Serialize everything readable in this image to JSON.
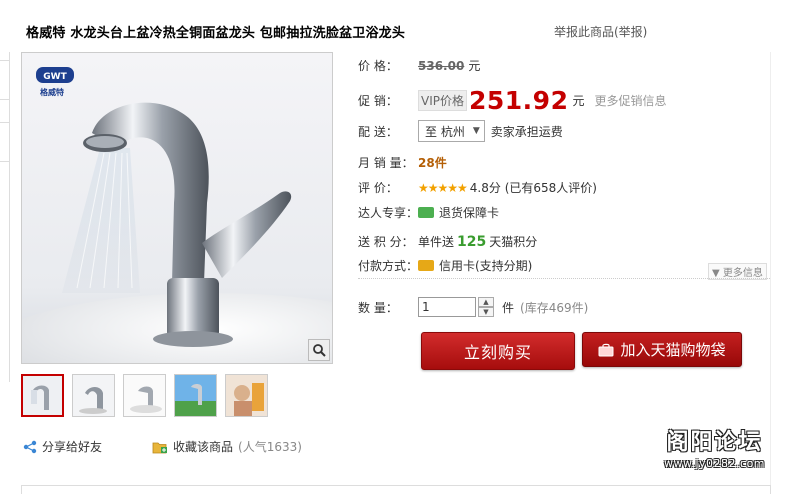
{
  "product": {
    "title": "格威特  水龙头台上盆冷热全铜面盆龙头  包邮抽拉洗脸盆卫浴龙头",
    "report": "举报此商品(举报)"
  },
  "image": {
    "brand_badge": "GWT",
    "brand_name": "格威特"
  },
  "price": {
    "label": "价    格：",
    "original": "536.00",
    "unit": "元",
    "promo_label": "促    销：",
    "vip_tag": "VIP价格",
    "current": "251.92",
    "more_promo": "更多促销信息"
  },
  "delivery": {
    "label": "配    送：",
    "destination": "至 杭州",
    "shipping": "卖家承担运费"
  },
  "sales": {
    "label": "月 销 量：",
    "value": "28件"
  },
  "rating": {
    "label": "评    价：",
    "stars": "★★★★★",
    "score": "4.8分 (已有658人评价)"
  },
  "expert": {
    "label": "达人专享：",
    "value": "退货保障卡"
  },
  "points": {
    "label": "送 积 分：",
    "prefix": "单件送",
    "value": "125",
    "suffix": "天猫积分"
  },
  "payment": {
    "label": "付款方式：",
    "value": "信用卡(支持分期)",
    "more": "更多信息"
  },
  "quantity": {
    "label": "数    量：",
    "value": "1",
    "unit": "件",
    "stock": "(库存469件)"
  },
  "actions": {
    "buy": "立刻购买",
    "cart": "加入天猫购物袋"
  },
  "social": {
    "share": "分享给好友",
    "favorite": "收藏该商品",
    "popularity": "(人气1633)"
  },
  "watermark": {
    "title": "阁阳论坛",
    "url": "www.jy0282.com"
  },
  "colors": {
    "accent": "#c40000",
    "points": "#3a9c2f",
    "stars": "#f2a100"
  }
}
